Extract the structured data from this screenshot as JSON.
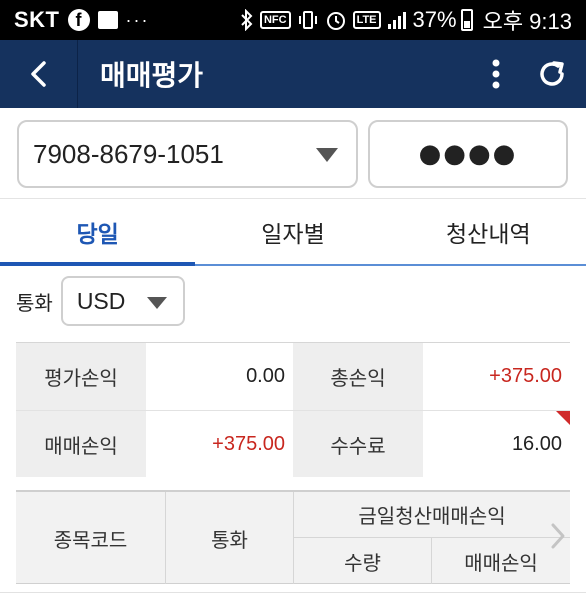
{
  "status_bar": {
    "carrier": "SKT",
    "dots": "···",
    "battery": "37%",
    "time": "오후 9:13",
    "nfc_label": "NFC",
    "lte_label": "LTE"
  },
  "header": {
    "title": "매매평가"
  },
  "account": {
    "number": "7908-8679-1051",
    "password_mask": "●●●●"
  },
  "tabs": [
    {
      "label": "당일",
      "active": true
    },
    {
      "label": "일자별",
      "active": false
    },
    {
      "label": "청산내역",
      "active": false
    }
  ],
  "currency": {
    "label": "통화",
    "value": "USD"
  },
  "summary": {
    "eval_pl_label": "평가손익",
    "eval_pl_value": "0.00",
    "total_pl_label": "총손익",
    "total_pl_value": "+375.00",
    "trade_pl_label": "매매손익",
    "trade_pl_value": "+375.00",
    "fee_label": "수수료",
    "fee_value": "16.00"
  },
  "detail_table": {
    "col_code": "종목코드",
    "col_currency": "통화",
    "group_header": "금일청산매매손익",
    "sub_qty": "수량",
    "sub_pl": "매매손익"
  },
  "colors": {
    "header_bg": "#15325e",
    "tab_active": "#1e57b4",
    "positive": "#c8271f"
  },
  "icons": {
    "back": "chevron-left-icon",
    "menu": "more-vertical-icon",
    "refresh": "refresh-icon",
    "scroll": "chevron-right-icon"
  }
}
